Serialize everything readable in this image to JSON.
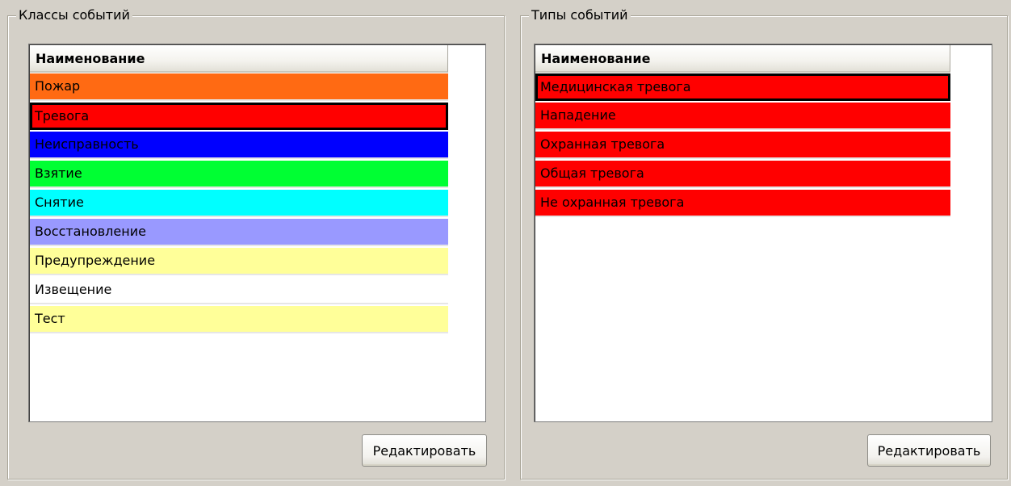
{
  "left_panel": {
    "title": "Классы событий",
    "column_header": "Наименование",
    "rows": [
      {
        "label": "Пожар",
        "color": "#ff6a13"
      },
      {
        "label": "Тревога",
        "color": "#ff0000",
        "selected": true
      },
      {
        "label": "Неисправность",
        "color": "#0000ff"
      },
      {
        "label": "Взятие",
        "color": "#00ff33"
      },
      {
        "label": "Снятие",
        "color": "#00ffff"
      },
      {
        "label": "Восстановление",
        "color": "#9999ff"
      },
      {
        "label": "Предупреждение",
        "color": "#ffff99"
      },
      {
        "label": "Извещение",
        "color": "#ffffff"
      },
      {
        "label": "Тест",
        "color": "#ffff99"
      }
    ],
    "edit_button": "Редактировать"
  },
  "right_panel": {
    "title": "Типы событий",
    "column_header": "Наименование",
    "rows": [
      {
        "label": "Медицинская тревога",
        "color": "#ff0000",
        "selected": true
      },
      {
        "label": "Нападение",
        "color": "#ff0000"
      },
      {
        "label": "Охранная тревога",
        "color": "#ff0000"
      },
      {
        "label": "Общая тревога",
        "color": "#ff0000"
      },
      {
        "label": "Не охранная тревога",
        "color": "#ff0000"
      }
    ],
    "edit_button": "Редактировать"
  }
}
